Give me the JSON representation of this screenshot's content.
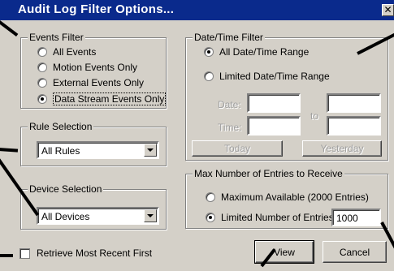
{
  "title": "Audit Log Filter Options...",
  "close_glyph": "✕",
  "events_filter": {
    "legend": "Events Filter",
    "options": [
      {
        "label": "All Events",
        "selected": false
      },
      {
        "label": "Motion Events Only",
        "selected": false
      },
      {
        "label": "External Events Only",
        "selected": false
      },
      {
        "label": "Data Stream Events Only",
        "selected": true
      }
    ]
  },
  "rule_selection": {
    "legend": "Rule Selection",
    "value": "All Rules"
  },
  "device_selection": {
    "legend": "Device Selection",
    "value": "All Devices"
  },
  "retrieve_recent": {
    "label": "Retrieve Most Recent First",
    "checked": false
  },
  "datetime_filter": {
    "legend": "Date/Time Filter",
    "all_label": "All Date/Time Range",
    "limited_label": "Limited Date/Time Range",
    "selected": "all",
    "date_label": "Date:",
    "time_label": "Time:",
    "to_label": "to",
    "today_label": "Today",
    "yesterday_label": "Yesterday"
  },
  "max_entries": {
    "legend": "Max Number of Entries to Receive",
    "max_label": "Maximum Available (2000 Entries)",
    "limited_label": "Limited Number of Entries:",
    "selected": "limited",
    "value": "1000"
  },
  "buttons": {
    "view": "View",
    "cancel": "Cancel"
  },
  "colors": {
    "title_bar": "#0a2a8c",
    "dialog_face": "#d4d0c8",
    "callout": "#000000"
  }
}
